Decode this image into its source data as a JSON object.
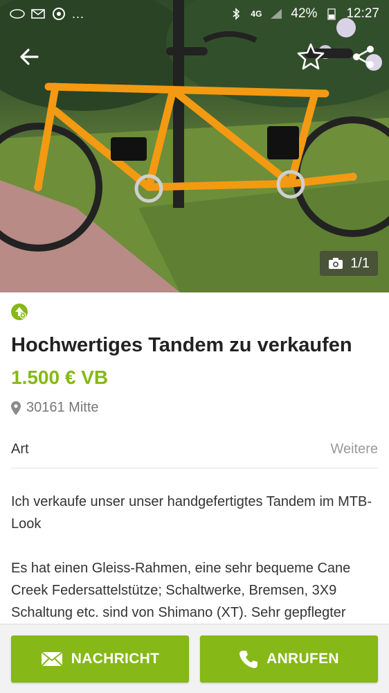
{
  "status_bar": {
    "battery": "42%",
    "time": "12:27",
    "network": "4G",
    "more": "..."
  },
  "photo": {
    "counter": "1/1"
  },
  "listing": {
    "title": "Hochwertiges Tandem zu verkaufen",
    "price": "1.500 € VB",
    "location": "30161 Mitte",
    "attribute": {
      "label": "Art",
      "value": "Weitere"
    },
    "description": [
      "Ich verkaufe unser unser handgefertigtes Tandem im MTB-Look",
      "Es hat einen Gleiss-Rahmen, eine sehr bequeme Cane Creek Federsattelstütze; Schaltwerke, Bremsen, 3X9 Schaltung etc. sind von Shimano (XT). Sehr gepflegter"
    ]
  },
  "actions": {
    "message_label": "NACHRICHT",
    "call_label": "ANRUFEN"
  },
  "icons": {
    "back": "arrow-left-icon",
    "favorite": "star-outline-icon",
    "share": "share-icon",
    "camera": "camera-icon",
    "top_ad": "up-arrow-badge-icon",
    "location": "map-pin-icon",
    "message": "envelope-icon",
    "call": "phone-icon"
  },
  "colors": {
    "accent": "#86b817",
    "text": "#333333",
    "muted": "#777777",
    "bottom_bar": "#f2f2f2"
  }
}
